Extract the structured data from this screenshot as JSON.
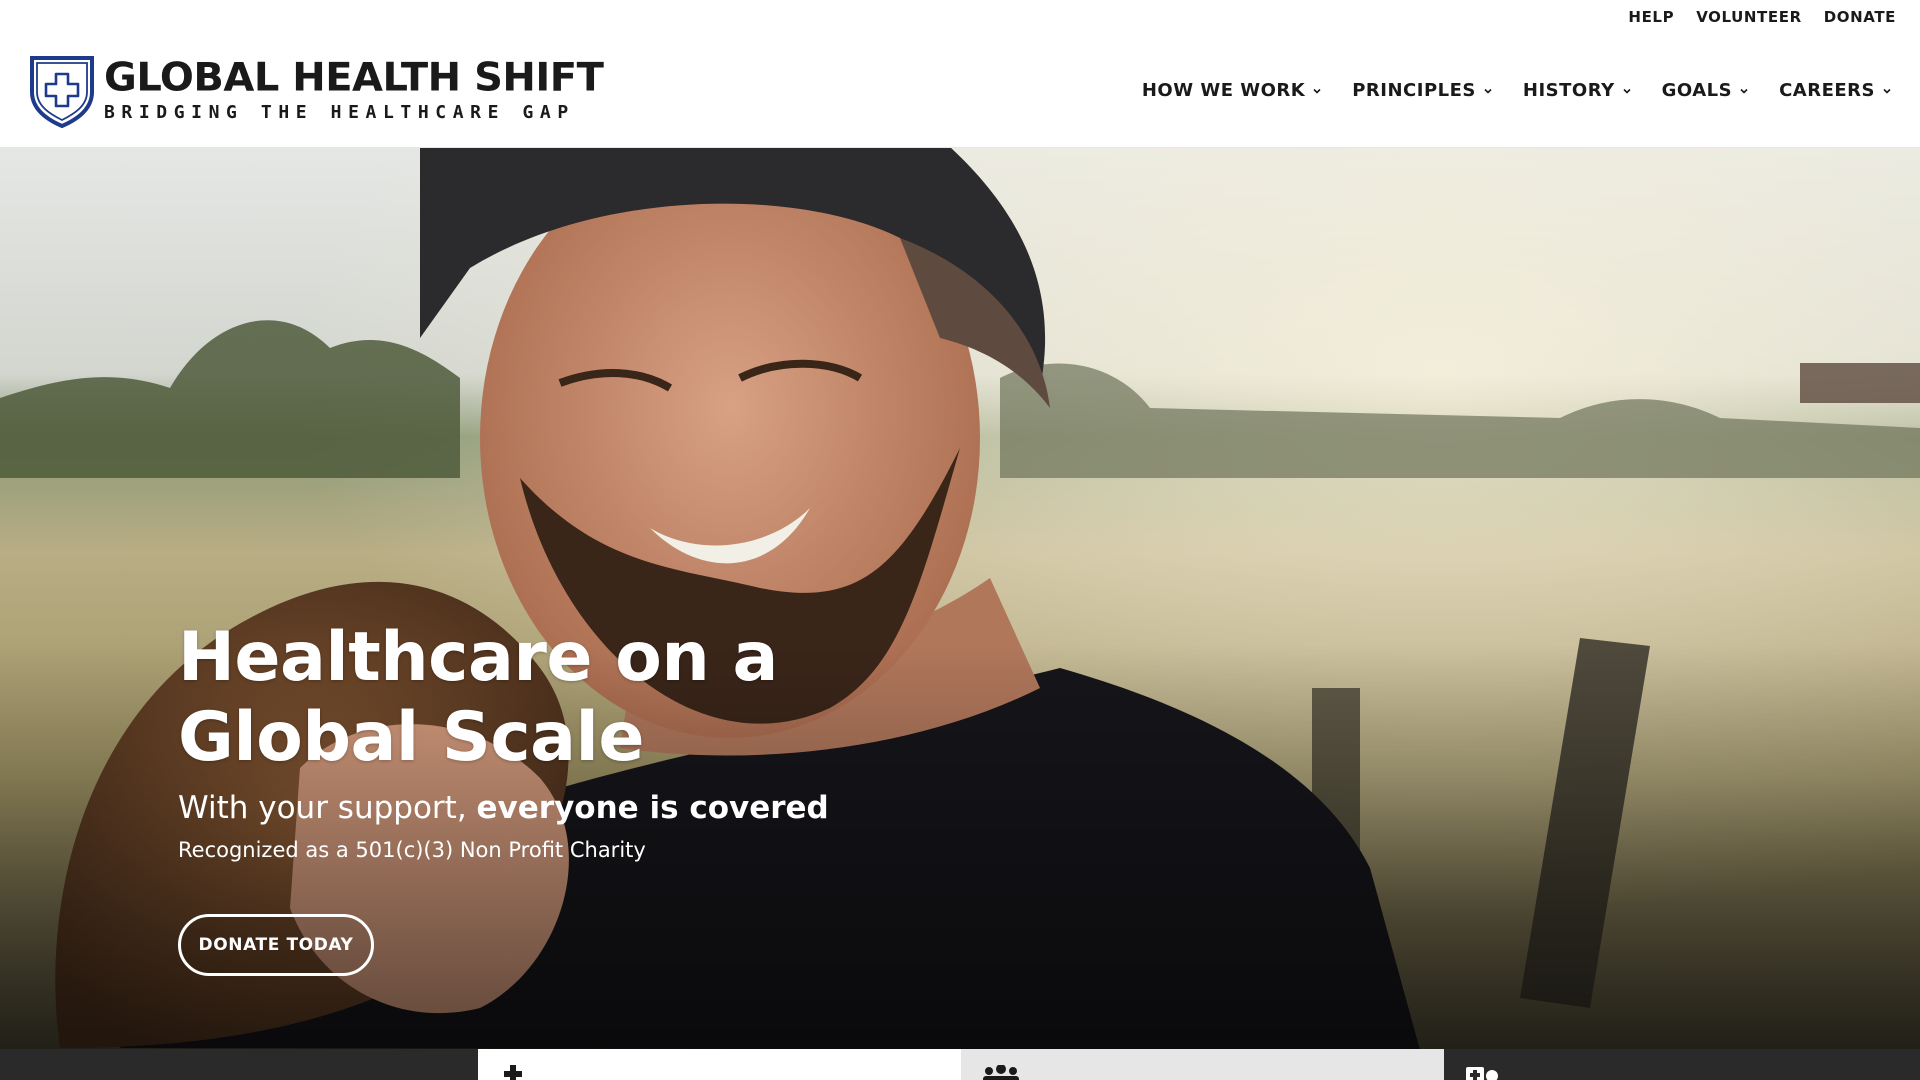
{
  "utility_nav": {
    "items": [
      {
        "label": "HELP"
      },
      {
        "label": "VOLUNTEER"
      },
      {
        "label": "DONATE"
      }
    ]
  },
  "brand": {
    "title": "GLOBAL HEALTH SHIFT",
    "tagline": "BRIDGING THE HEALTHCARE GAP",
    "logo_icon": "shield-cross-icon",
    "accent_color": "#1e3a8a"
  },
  "main_nav": {
    "items": [
      {
        "label": "HOW WE WORK",
        "icon": "chevron-down-icon"
      },
      {
        "label": "PRINCIPLES",
        "icon": "chevron-down-icon"
      },
      {
        "label": "HISTORY",
        "icon": "chevron-down-icon"
      },
      {
        "label": "GOALS",
        "icon": "chevron-down-icon"
      },
      {
        "label": "CAREERS",
        "icon": "chevron-down-icon"
      }
    ]
  },
  "hero": {
    "title_line1": "Healthcare on a",
    "title_line2": "Global Scale",
    "subtitle_plain": "With your support, ",
    "subtitle_bold": "everyone is covered",
    "note": "Recognized as a 501(c)(3) Non Profit Charity",
    "cta_label": "DONATE TODAY",
    "background_image": "photo of smiling bearded man hugging a child in a field"
  },
  "bottom_tabs": {
    "items": [
      {
        "icon": "medical-cross-icon",
        "bg": "#ffffff"
      },
      {
        "icon": "people-group-icon",
        "bg": "#e6e6e6"
      },
      {
        "icon": "medical-kit-icon",
        "bg": "#2a2a2a"
      }
    ]
  },
  "colors": {
    "text_dark": "#1a1a1a",
    "footer_bar": "#2a2a2a",
    "white": "#ffffff"
  }
}
